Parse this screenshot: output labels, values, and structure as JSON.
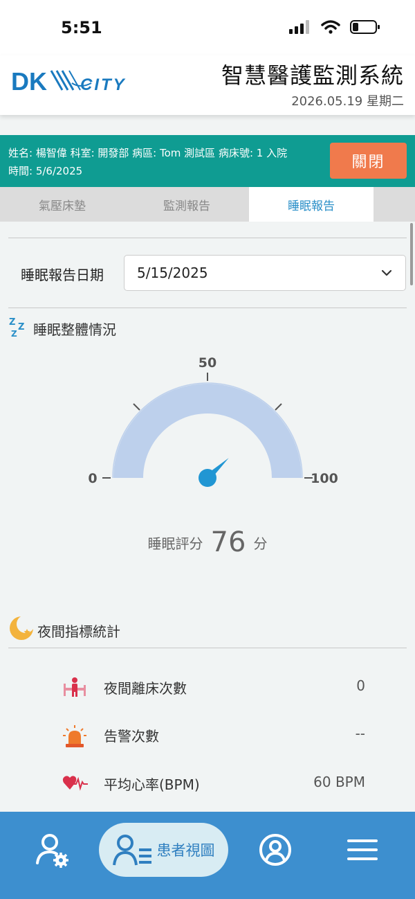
{
  "status_bar": {
    "time": "5:51"
  },
  "header": {
    "logo_text": "DK CITY",
    "system_title": "智慧醫護監測系統",
    "date": "2026.05.19 星期二"
  },
  "patient": {
    "line1": "姓名: 楊智偉 科室: 開發部 病區: Tom 測試區 病床號: 1 入院",
    "line2": "時間: 5/6/2025",
    "close_label": "關閉"
  },
  "tabs": [
    {
      "label": "氣壓床墊",
      "active": false
    },
    {
      "label": "監測報告",
      "active": false
    },
    {
      "label": "睡眠報告",
      "active": true
    }
  ],
  "report_date": {
    "label": "睡眠報告日期",
    "value": "5/15/2025"
  },
  "sleep_overall": {
    "title": "睡眠整體情況",
    "gauge": {
      "min_label": "0",
      "mid_label": "50",
      "max_label": "100",
      "min": 0,
      "max": 100,
      "value": 76
    },
    "score_label": "睡眠評分",
    "score_value": "76",
    "score_unit": "分"
  },
  "night_stats": {
    "title": "夜間指標統計",
    "items": [
      {
        "label": "夜間離床次數",
        "value": "0",
        "icon": "bed-exit-icon"
      },
      {
        "label": "告警次數",
        "value": "--",
        "icon": "alarm-siren-icon"
      },
      {
        "label": "平均心率(BPM)",
        "value": "60 BPM",
        "icon": "heart-rate-icon"
      }
    ]
  },
  "bottom_nav": {
    "active_label": "患者視圖",
    "items": [
      "user-settings-icon",
      "patient-view-icon",
      "profile-icon",
      "menu-icon"
    ]
  },
  "colors": {
    "banner": "#0f9c92",
    "close_button": "#f07a4c",
    "active_tab_text": "#2a8fc8",
    "gauge_arc": "#bdd0ec",
    "needle": "#2196d3",
    "bottom_nav": "#3d8fcf"
  }
}
